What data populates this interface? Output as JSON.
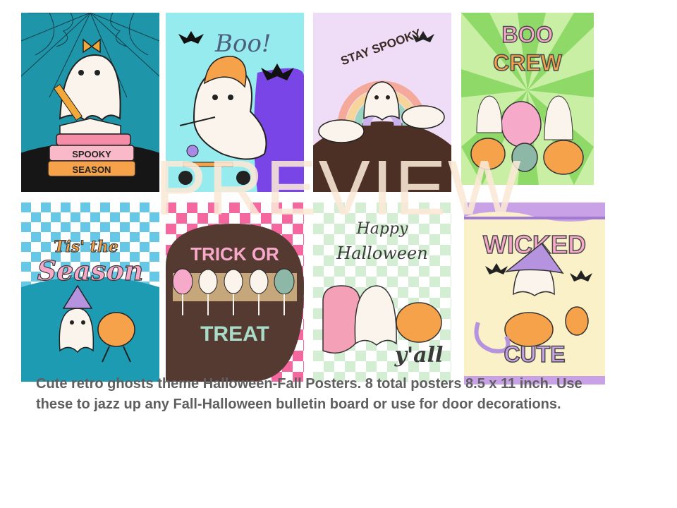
{
  "posters": [
    {
      "name": "Spooky Season",
      "texts": [
        "SPOOKY",
        "SEASON"
      ]
    },
    {
      "name": "Boo",
      "texts": [
        "Boo!"
      ]
    },
    {
      "name": "Stay Spooky",
      "texts": [
        "STAY SPOOKY"
      ]
    },
    {
      "name": "Boo Crew",
      "texts": [
        "BOO",
        "CREW"
      ]
    },
    {
      "name": "Tis the Season",
      "texts": [
        "Tis' the",
        "Season"
      ]
    },
    {
      "name": "Trick or Treat",
      "texts": [
        "TRICK OR",
        "TREAT"
      ]
    },
    {
      "name": "Happy Halloween B yall",
      "texts": [
        "Happy",
        "Halloween",
        "y'all"
      ]
    },
    {
      "name": "Wicked Cute",
      "texts": [
        "WICKED",
        "CUTE"
      ]
    }
  ],
  "watermark": "PREVIEW",
  "description": "Cute retro ghosts theme Halloween-Fall Posters. 8 total posters 8.5 x 11 inch. Use these to jazz up any Fall-Halloween bulletin board or use for door decorations.",
  "colors": {
    "watermark": "#fae8d6",
    "text": "#5f5f5f"
  }
}
